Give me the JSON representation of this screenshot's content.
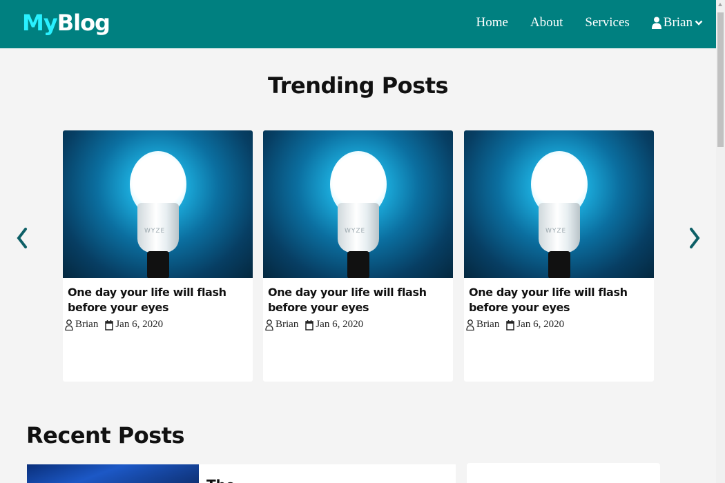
{
  "header": {
    "logo_part1": "My",
    "logo_part2": "Blog",
    "nav": [
      "Home",
      "About",
      "Services"
    ],
    "user_name": "Brian",
    "background_color": "#008080",
    "logo_accent_color": "#29f0ff"
  },
  "trending": {
    "title": "Trending Posts",
    "posts": [
      {
        "title": "One day your life will flash before your eyes",
        "author": "Brian",
        "date": "Jan 6, 2020",
        "image_text": "WYZE"
      },
      {
        "title": "One day your life will flash before your eyes",
        "author": "Brian",
        "date": "Jan 6, 2020",
        "image_text": "WYZE"
      },
      {
        "title": "One day your life will flash before your eyes",
        "author": "Brian",
        "date": "Jan 6, 2020",
        "image_text": "WYZE"
      }
    ],
    "prev_icon": "chevron-left-icon",
    "next_icon": "chevron-right-icon"
  },
  "recent": {
    "title": "Recent Posts",
    "first_post_title_partial": "The ... ... ... ..."
  }
}
